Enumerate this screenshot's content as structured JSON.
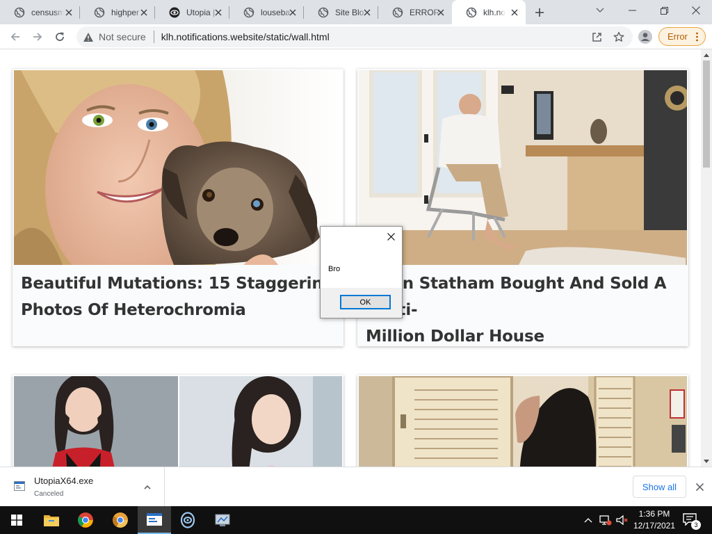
{
  "browser": {
    "tabs": [
      {
        "title": "censusm",
        "favicon": "globe-icon"
      },
      {
        "title": "highper",
        "favicon": "globe-icon"
      },
      {
        "title": "Utopia |",
        "favicon": "eye-logo-icon"
      },
      {
        "title": "louseba",
        "favicon": "globe-icon"
      },
      {
        "title": "Site Blo",
        "favicon": "globe-icon"
      },
      {
        "title": "ERROR:",
        "favicon": "globe-icon"
      },
      {
        "title": "klh.noti",
        "favicon": "globe-icon",
        "active": true
      }
    ],
    "security_label": "Not secure",
    "url": "klh.notifications.website/static/wall.html",
    "error_label": "Error"
  },
  "page": {
    "cards": [
      {
        "headline_line1": "Beautiful Mutations: 15 Staggering",
        "headline_line2": "Photos Of Heterochromia"
      },
      {
        "headline_line1": "Jason Statham Bought And Sold A Multi-",
        "headline_line2": "Million Dollar House"
      },
      {
        "headline_line1": "",
        "headline_line2": ""
      },
      {
        "headline_line1": "",
        "headline_line2": ""
      }
    ]
  },
  "dialog": {
    "message": "Bro",
    "ok_label": "OK"
  },
  "downloads": {
    "filename": "UtopiaX64.exe",
    "status": "Canceled",
    "show_all_label": "Show all"
  },
  "taskbar": {
    "time": "1:36 PM",
    "date": "12/17/2021",
    "notification_count": "3"
  },
  "colors": {
    "tabstrip_bg": "#dee1e6",
    "omnibox_bg": "#f1f3f4",
    "error_orange": "#e8a33d",
    "link_blue": "#1a73e8",
    "taskbar_bg": "#101010"
  }
}
